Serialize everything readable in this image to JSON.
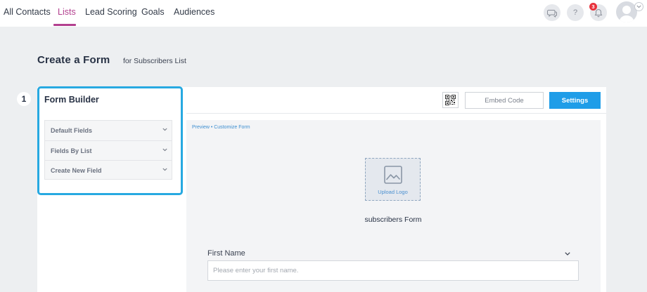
{
  "nav": {
    "items": [
      {
        "label": "All Contacts",
        "active": false
      },
      {
        "label": "Lists",
        "active": true
      },
      {
        "label": "Lead Scoring",
        "active": false
      },
      {
        "label": "Goals",
        "active": false
      },
      {
        "label": "Audiences",
        "active": false
      }
    ],
    "help_label": "?",
    "notification_count": "3",
    "icons": [
      "chat-icon",
      "help-icon",
      "bell-icon",
      "avatar-icon",
      "chevron-down-icon"
    ],
    "active_color": "#b3408f"
  },
  "page": {
    "title": "Create a Form",
    "subtitle": "for Subscribers List",
    "step_number": "1"
  },
  "form_builder": {
    "title": "Form Builder",
    "items": [
      {
        "label": "Default Fields"
      },
      {
        "label": "Fields By List"
      },
      {
        "label": "Create New Field"
      }
    ],
    "highlight_color": "#27a9e1"
  },
  "toolbar": {
    "embed_label": "Embed Code",
    "settings_label": "Settings",
    "settings_color": "#1f9de8"
  },
  "preview": {
    "link_label": "Preview • Customize Form",
    "upload_logo_label": "Upload Logo",
    "form_name": "subscribers Form",
    "field": {
      "label": "First Name",
      "placeholder": "Please enter your first name.",
      "value": ""
    }
  }
}
